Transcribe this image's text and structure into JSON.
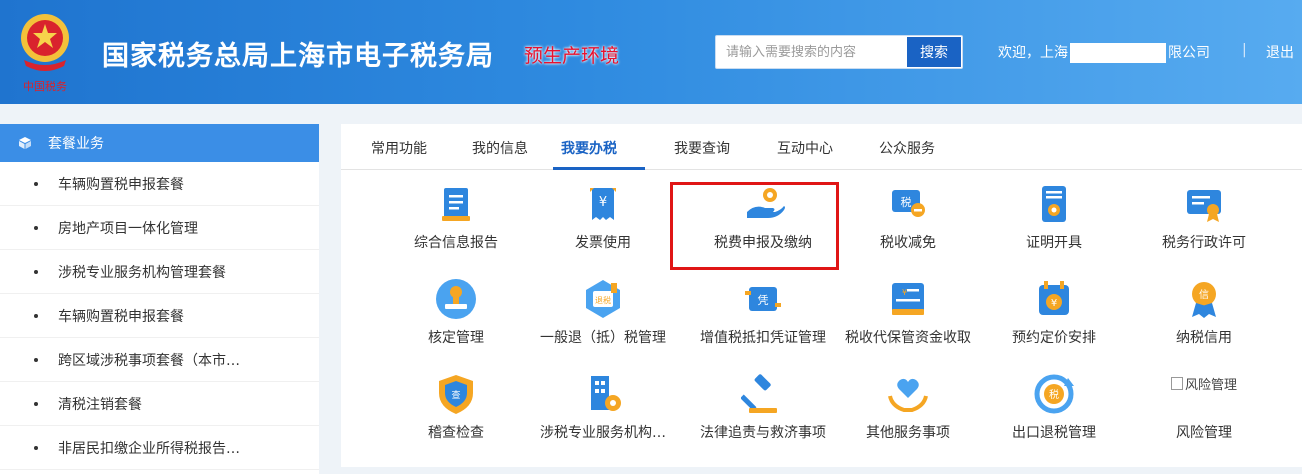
{
  "header": {
    "site_title": "国家税务总局上海市电子税务局",
    "env_tag": "预生产环境",
    "emblem_caption": "中国税务",
    "search": {
      "placeholder": "请输入需要搜索的内容",
      "button": "搜索"
    },
    "welcome_prefix": "欢迎，上海",
    "welcome_suffix": "限公司",
    "separator": "|",
    "logout": "退出"
  },
  "sidebar": {
    "title": "套餐业务",
    "items": [
      "车辆购置税申报套餐",
      "房地产项目一体化管理",
      "涉税专业服务机构管理套餐",
      "车辆购置税申报套餐",
      "跨区域涉税事项套餐（本市…",
      "清税注销套餐",
      "非居民扣缴企业所得税报告…"
    ]
  },
  "tabs": [
    "常用功能",
    "我的信息",
    "我要办税",
    "我要查询",
    "互动中心",
    "公众服务"
  ],
  "active_tab": 2,
  "functions": [
    {
      "label": "综合信息报告",
      "icon": "report-icon"
    },
    {
      "label": "发票使用",
      "icon": "invoice-icon"
    },
    {
      "label": "税费申报及缴纳",
      "icon": "hand-coin-icon"
    },
    {
      "label": "税收减免",
      "icon": "tax-reduction-icon"
    },
    {
      "label": "证明开具",
      "icon": "certificate-icon"
    },
    {
      "label": "税务行政许可",
      "icon": "license-icon"
    },
    {
      "label": "核定管理",
      "icon": "stamp-icon"
    },
    {
      "label": "一般退（抵）税管理",
      "icon": "refund-icon"
    },
    {
      "label": "增值税抵扣凭证管理",
      "icon": "voucher-icon"
    },
    {
      "label": "税收代保管资金收取",
      "icon": "custody-icon"
    },
    {
      "label": "预约定价安排",
      "icon": "calendar-price-icon"
    },
    {
      "label": "纳税信用",
      "icon": "credit-medal-icon"
    },
    {
      "label": "稽查检查",
      "icon": "shield-check-icon"
    },
    {
      "label": "涉税专业服务机构…",
      "icon": "building-icon"
    },
    {
      "label": "法律追责与救济事项",
      "icon": "gavel-icon"
    },
    {
      "label": "其他服务事项",
      "icon": "heart-hands-icon"
    },
    {
      "label": "出口退税管理",
      "icon": "export-refund-icon"
    },
    {
      "label": "风险管理",
      "icon": "risk-icon",
      "broken_alt": "风险管理"
    }
  ],
  "highlighted_function": 2,
  "colors": {
    "header_blue": "#1f74cf",
    "accent_blue": "#1a63c4",
    "icon_orange": "#f5a623",
    "highlight_red": "#e01515",
    "env_red": "#e8112d"
  }
}
